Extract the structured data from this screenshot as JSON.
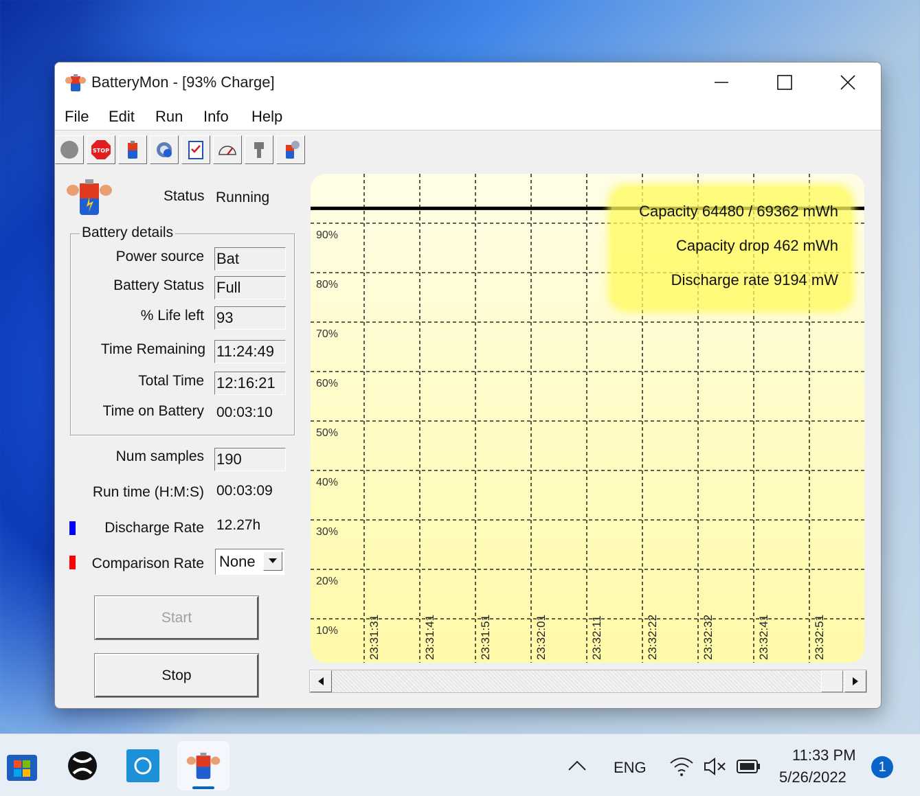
{
  "window": {
    "title": "BatteryMon - [93% Charge]",
    "menu": [
      "File",
      "Edit",
      "Run",
      "Info",
      "Help"
    ]
  },
  "toolbar": {
    "icons": [
      "record-icon",
      "stop-sign-icon",
      "battery-icon",
      "settings-icon",
      "checklist-icon",
      "gauge-icon",
      "plug-icon",
      "battery-info-icon"
    ]
  },
  "status": {
    "label": "Status",
    "value": "Running"
  },
  "battery_details": {
    "title": "Battery details",
    "power_source": {
      "label": "Power source",
      "value": "Bat"
    },
    "battery_status": {
      "label": "Battery Status",
      "value": "Full"
    },
    "life_left": {
      "label": "% Life left",
      "value": "93"
    },
    "time_remaining": {
      "label": "Time Remaining",
      "value": "11:24:49"
    },
    "total_time": {
      "label": "Total Time",
      "value": "12:16:21"
    },
    "time_on_battery": {
      "label": "Time on Battery",
      "value": "00:03:10"
    }
  },
  "stats": {
    "num_samples": {
      "label": "Num samples",
      "value": "190"
    },
    "run_time": {
      "label": "Run time (H:M:S)",
      "value": "00:03:09"
    },
    "discharge_rate": {
      "label": "Discharge Rate",
      "value": "12.27h",
      "color": "#0000ff"
    },
    "comparison_rate": {
      "label": "Comparison Rate",
      "value": "None",
      "color": "#ff0000"
    }
  },
  "buttons": {
    "start": "Start",
    "stop": "Stop"
  },
  "overlay": {
    "capacity": "Capacity 64480 / 69362 mWh",
    "capacity_drop": "Capacity drop 462 mWh",
    "discharge_rate": "Discharge rate 9194 mW"
  },
  "chart_data": {
    "type": "line",
    "y_ticks": [
      "90%",
      "80%",
      "70%",
      "60%",
      "50%",
      "40%",
      "30%",
      "20%",
      "10%"
    ],
    "x_ticks": [
      "23:31:31",
      "23:31:41",
      "23:31:51",
      "23:32:01",
      "23:32:11",
      "23:32:22",
      "23:32:32",
      "23:32:41",
      "23:32:51"
    ],
    "ylim": [
      0,
      100
    ],
    "series": [
      {
        "values": [
          93,
          93,
          93,
          93,
          93,
          93,
          93,
          93,
          93,
          93
        ],
        "color": "#000000"
      }
    ],
    "grid": true,
    "background": "#fffaa8"
  },
  "taskbar": {
    "apps": [
      "start-icon",
      "xbox-icon",
      "app-icon",
      "batterymon-icon"
    ],
    "language": "ENG",
    "time": "11:33 PM",
    "date": "5/26/2022",
    "notification_count": "1"
  }
}
